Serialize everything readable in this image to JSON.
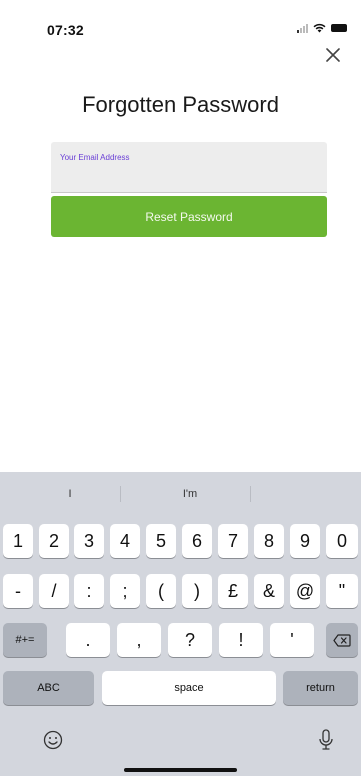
{
  "status_bar": {
    "time": "07:32"
  },
  "screen": {
    "title": "Forgotten Password",
    "email_label": "Your Email Address",
    "email_value": "",
    "reset_button": "Reset Password"
  },
  "keyboard": {
    "suggestions": [
      "I",
      "I'm",
      ""
    ],
    "row1": [
      "1",
      "2",
      "3",
      "4",
      "5",
      "6",
      "7",
      "8",
      "9",
      "0"
    ],
    "row2": [
      "-",
      "/",
      ":",
      ";",
      "(",
      ")",
      "£",
      "&",
      "@",
      "\""
    ],
    "row3_toggle": "#+=",
    "row3": [
      ".",
      ",",
      "?",
      "!",
      "'"
    ],
    "abc": "ABC",
    "space": "space",
    "return": "return"
  },
  "colors": {
    "accent": "#6bb532",
    "label": "#6a3fd6"
  },
  "icons": [
    "close-icon",
    "signal-icon",
    "wifi-icon",
    "battery-icon",
    "backspace-icon",
    "emoji-icon",
    "microphone-icon"
  ]
}
